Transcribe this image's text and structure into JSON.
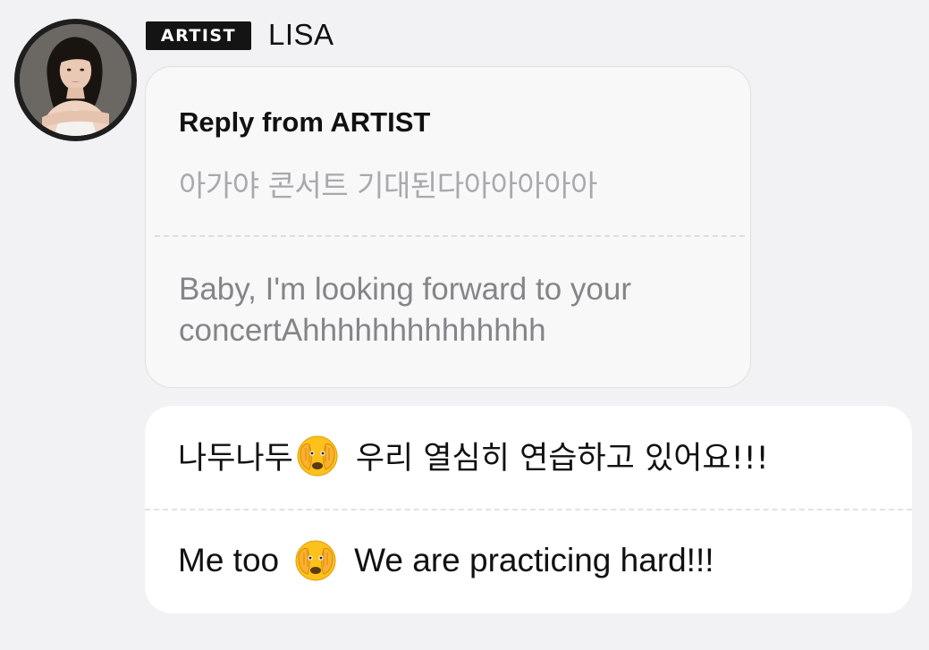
{
  "author": {
    "badge": "ARTIST",
    "name": "LISA"
  },
  "reply": {
    "title": "Reply from ARTIST",
    "original_text": "아가야 콘서트 기대된다아아아아아",
    "translated_text": "Baby, I'm looking forward to your concertAhhhhhhhhhhhhhh"
  },
  "message": {
    "korean_before": "나두나두",
    "korean_after": "우리 열심히 연습하고 있어요!!!",
    "english_before": "Me too",
    "english_after": "We are practicing hard!!!",
    "emoji_icon": "face-with-peeking-eye-emoji"
  },
  "colors": {
    "background": "#f2f2f4",
    "badge_bg": "#141414",
    "reply_card_bg": "#f8f8f9",
    "message_card_bg": "#ffffff",
    "muted_text": "#a9a9ad"
  }
}
